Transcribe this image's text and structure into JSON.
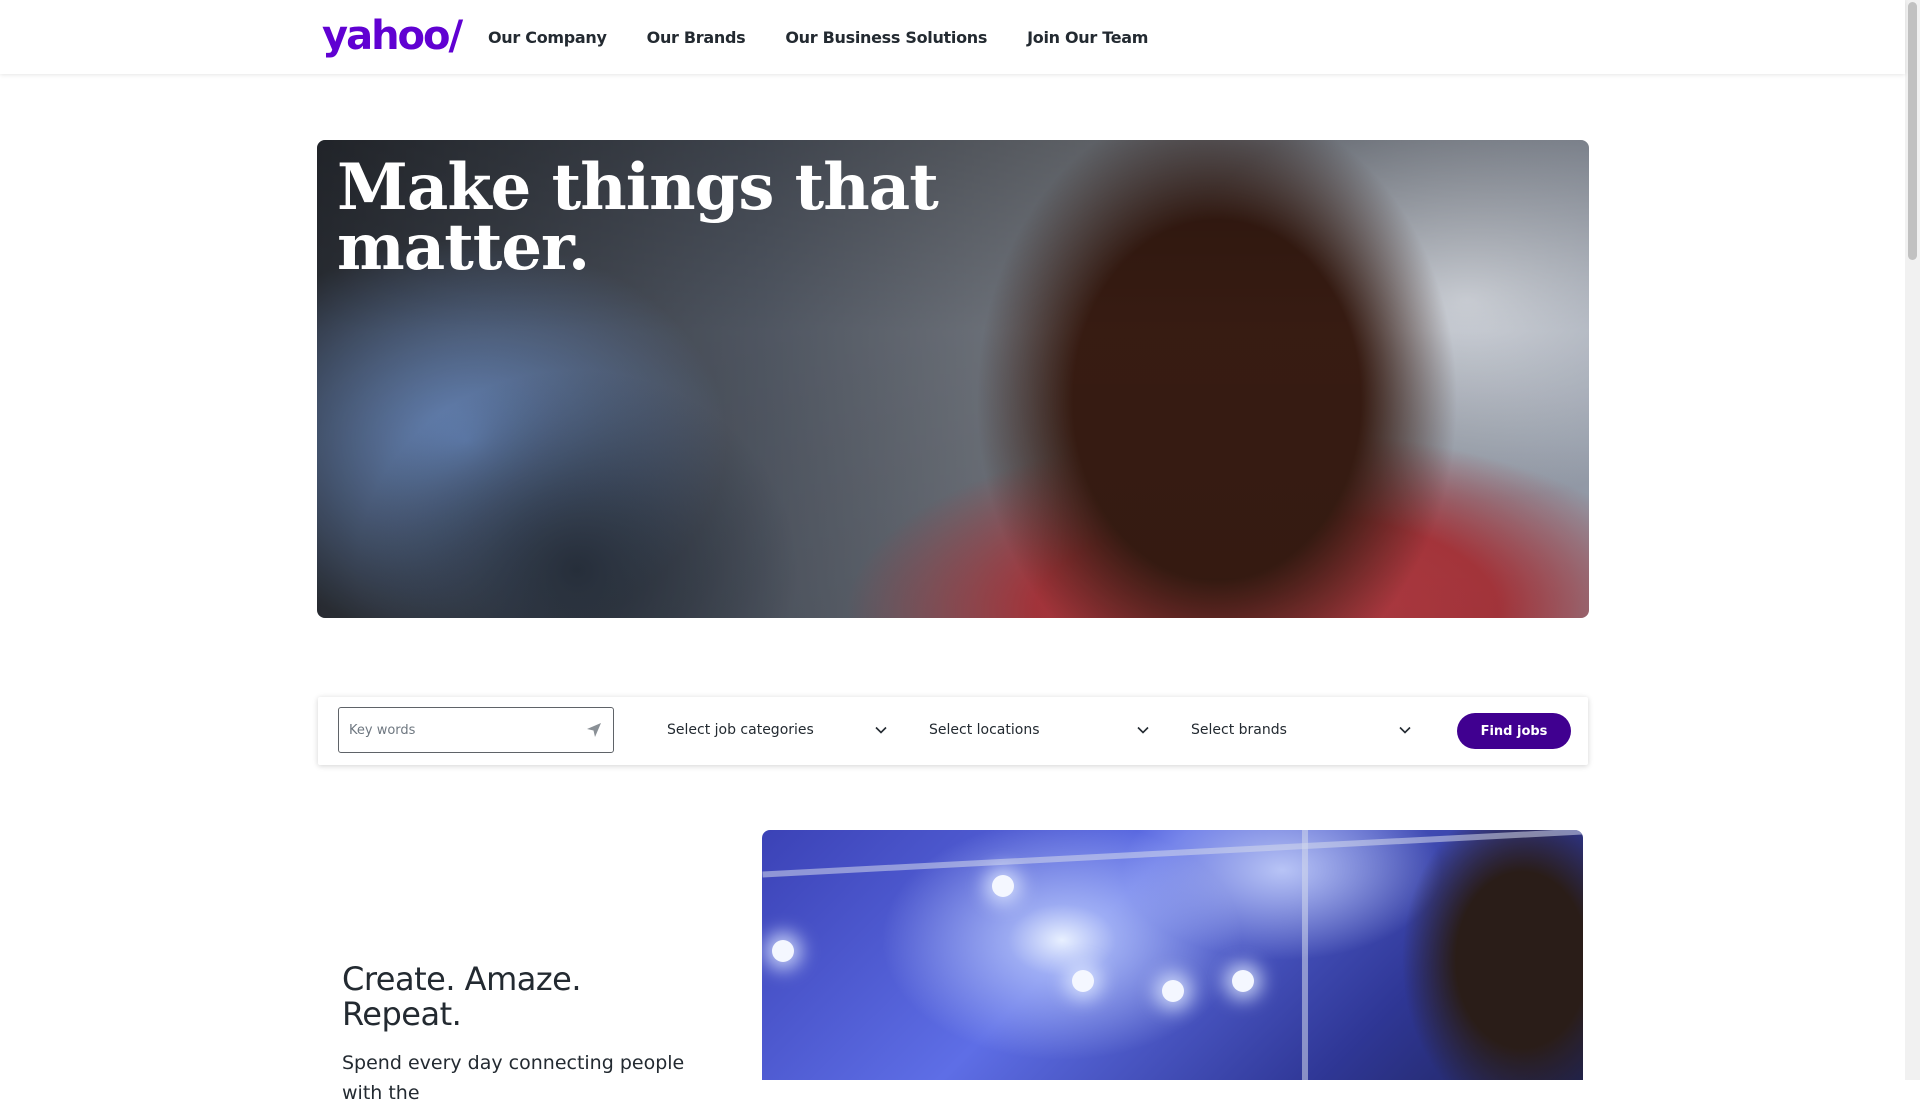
{
  "header": {
    "logo": "yahoo/",
    "nav": [
      "Our Company",
      "Our Brands",
      "Our Business Solutions",
      "Join Our Team"
    ]
  },
  "hero": {
    "title": "Make things that matter."
  },
  "search": {
    "keywords_placeholder": "Key words",
    "keywords_value": "",
    "categories_label": "Select job categories",
    "locations_label": "Select locations",
    "brands_label": "Select brands",
    "find_button": "Find jobs"
  },
  "feature": {
    "title": "Create. Amaze. Repeat.",
    "body": "Spend every day connecting people with the"
  },
  "colors": {
    "brand_purple": "#6001d2",
    "button_purple": "#400090",
    "text": "#232a31"
  },
  "icons": {
    "location": "location-arrow-icon",
    "chevron": "chevron-down-icon"
  }
}
